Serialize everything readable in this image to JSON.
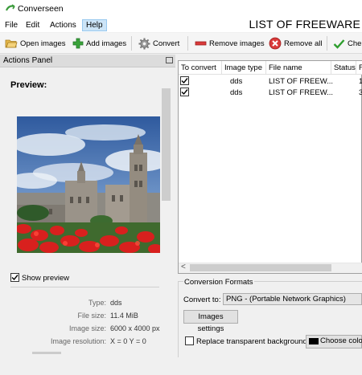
{
  "window": {
    "title": "Converseen",
    "document_title": "LIST OF FREEWARE"
  },
  "menu": [
    {
      "label": "File"
    },
    {
      "label": "Edit"
    },
    {
      "label": "Actions"
    },
    {
      "label": "Help"
    }
  ],
  "toolbar": {
    "open_images": "Open images",
    "add_images": "Add images",
    "convert": "Convert",
    "remove_images": "Remove images",
    "remove_all": "Remove all",
    "check_label": "Che"
  },
  "actions_panel": {
    "title": "Actions Panel",
    "preview_label": "Preview:",
    "show_preview": "Show preview",
    "show_preview_checked": true,
    "info": {
      "type_key": "Type:",
      "type_val": "dds",
      "size_key": "File size:",
      "size_val": "11.4 MiB",
      "imgsize_key": "Image size:",
      "imgsize_val": "6000 x 4000 px",
      "res_key": "Image resolution:",
      "res_val": "X = 0 Y = 0"
    }
  },
  "table": {
    "headers": {
      "to_convert": "To convert",
      "image_type": "Image type",
      "file_name": "File name",
      "status": "Status",
      "extra": "F"
    },
    "rows": [
      {
        "checked": true,
        "type": "dds",
        "name": "LIST OF FREEW...",
        "extra": "1"
      },
      {
        "checked": true,
        "type": "dds",
        "name": "LIST OF FREEW...",
        "extra": "3"
      }
    ],
    "scroll_left_glyph": "<"
  },
  "conversion": {
    "title": "Conversion Formats",
    "convert_to_label": "Convert to:",
    "format_value": "PNG - (Portable Network Graphics)",
    "images_settings": "Images settings",
    "replace_transparent": "Replace transparent background",
    "replace_checked": false,
    "choose_color": "Choose color",
    "swatch_color": "#000000"
  },
  "colors": {
    "help_highlight": "#cce4f7",
    "add_green": "#3aa33a",
    "remove_red": "#d93a3a",
    "check_green": "#2e9e2e"
  }
}
